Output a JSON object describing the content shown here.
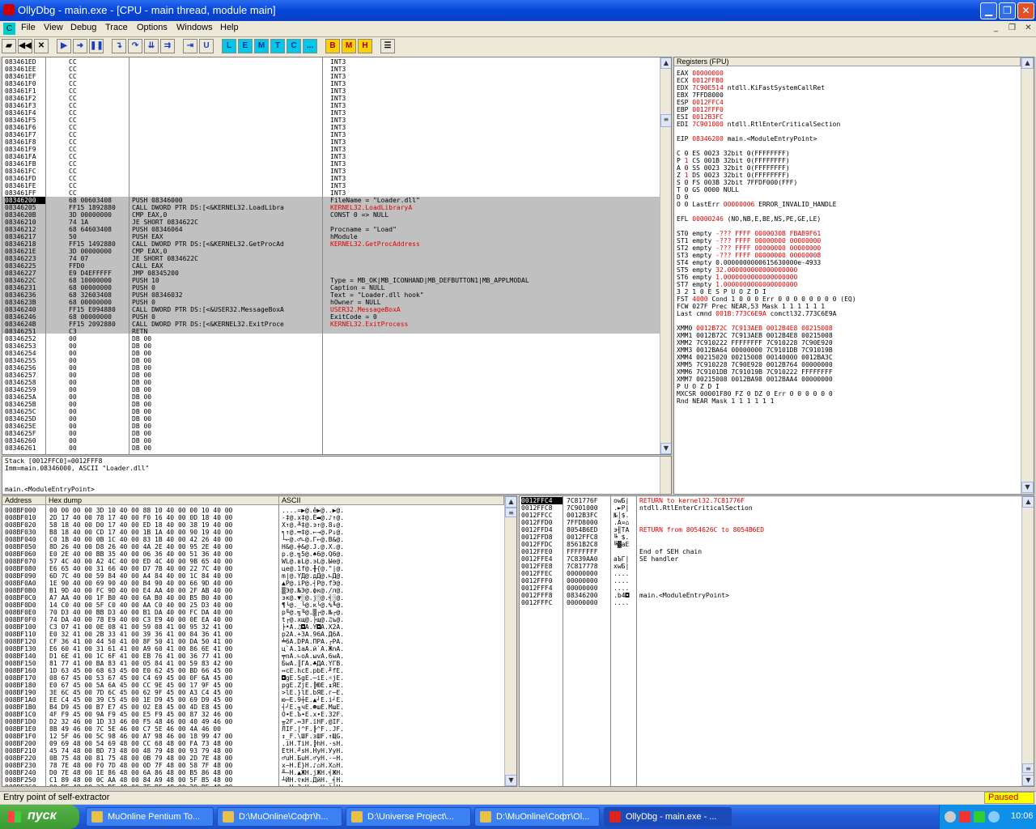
{
  "window": {
    "title": "OllyDbg - main.exe - [CPU - main thread, module main]",
    "minimize": "▁",
    "restore": "❐",
    "close": "✕"
  },
  "menu": {
    "icon": "C",
    "items": [
      "File",
      "View",
      "Debug",
      "Trace",
      "Options",
      "Windows",
      "Help"
    ],
    "mdi": [
      "_",
      "❐",
      "✕"
    ]
  },
  "toolbar": [
    "L",
    "E",
    "M",
    "T",
    "C",
    "...",
    "B",
    "M",
    "H"
  ],
  "disasm": {
    "rows": [
      [
        "083461ED",
        "CC",
        "",
        "INT3",
        "",
        ""
      ],
      [
        "083461EE",
        "CC",
        "",
        "INT3",
        "",
        ""
      ],
      [
        "083461EF",
        "CC",
        "",
        "INT3",
        "",
        ""
      ],
      [
        "083461F0",
        "CC",
        "",
        "INT3",
        "",
        ""
      ],
      [
        "083461F1",
        "CC",
        "",
        "INT3",
        "",
        ""
      ],
      [
        "083461F2",
        "CC",
        "",
        "INT3",
        "",
        ""
      ],
      [
        "083461F3",
        "CC",
        "",
        "INT3",
        "",
        ""
      ],
      [
        "083461F4",
        "CC",
        "",
        "INT3",
        "",
        ""
      ],
      [
        "083461F5",
        "CC",
        "",
        "INT3",
        "",
        ""
      ],
      [
        "083461F6",
        "CC",
        "",
        "INT3",
        "",
        ""
      ],
      [
        "083461F7",
        "CC",
        "",
        "INT3",
        "",
        ""
      ],
      [
        "083461F8",
        "CC",
        "",
        "INT3",
        "",
        ""
      ],
      [
        "083461F9",
        "CC",
        "",
        "INT3",
        "",
        ""
      ],
      [
        "083461FA",
        "CC",
        "",
        "INT3",
        "",
        ""
      ],
      [
        "083461FB",
        "CC",
        "",
        "INT3",
        "",
        ""
      ],
      [
        "083461FC",
        "CC",
        "",
        "INT3",
        "",
        ""
      ],
      [
        "083461FD",
        "CC",
        "",
        "INT3",
        "",
        ""
      ],
      [
        "083461FE",
        "CC",
        "",
        "INT3",
        "",
        ""
      ],
      [
        "083461FF",
        "CC",
        "",
        "INT3",
        "",
        ""
      ],
      [
        "08346200",
        "68 00603408",
        "PUSH 08346000",
        "FileName = \"Loader.dll\"",
        "g",
        "s"
      ],
      [
        "08346205",
        "FF15 1892880",
        "CALL DWORD PTR DS:[<&KERNEL32.LoadLibra",
        "KERNEL32.LoadLibraryA",
        "r",
        "h"
      ],
      [
        "0834620B",
        "3D 00000000",
        "CMP EAX,0",
        "CONST 0 => NULL",
        "",
        "h"
      ],
      [
        "08346210",
        "74 1A",
        "JE SHORT 0834622C",
        "",
        "",
        "h"
      ],
      [
        "08346212",
        "68 64603408",
        "PUSH 08346064",
        "Procname = \"Load\"",
        "g",
        "h"
      ],
      [
        "08346217",
        "50",
        "PUSH EAX",
        "hModule",
        "g",
        "h"
      ],
      [
        "08346218",
        "FF15 1492880",
        "CALL DWORD PTR DS:[<&KERNEL32.GetProcAd",
        "KERNEL32.GetProcAddress",
        "r",
        "h"
      ],
      [
        "0834621E",
        "3D 00000000",
        "CMP EAX,0",
        "",
        "",
        "h"
      ],
      [
        "08346223",
        "74 07",
        "JE SHORT 0834622C",
        "",
        "",
        "h"
      ],
      [
        "08346225",
        "FFD0",
        "CALL EAX",
        "",
        "",
        "h"
      ],
      [
        "08346227",
        "E9 D4EFFFFF",
        "JMP 08345200",
        "",
        "",
        "h"
      ],
      [
        "0834622C",
        "68 10000000",
        "PUSH 10",
        "Type = MB_OK|MB_ICONHAND|MB_DEFBUTTON1|MB_APPLMODAL",
        "g",
        "h"
      ],
      [
        "08346231",
        "68 00000000",
        "PUSH 0",
        "Caption = NULL",
        "g",
        "h"
      ],
      [
        "08346236",
        "68 32603408",
        "PUSH 08346032",
        "Text = \"Loader.dll hook\"",
        "g",
        "h"
      ],
      [
        "0834623B",
        "68 00000000",
        "PUSH 0",
        "hOwner = NULL",
        "g",
        "h"
      ],
      [
        "08346240",
        "FF15 E094880",
        "CALL DWORD PTR DS:[<&USER32.MessageBoxA",
        "USER32.MessageBoxA",
        "r",
        "h"
      ],
      [
        "08346246",
        "68 00000000",
        "PUSH 0",
        "ExitCode = 0",
        "g",
        "h"
      ],
      [
        "0834624B",
        "FF15 2092880",
        "CALL DWORD PTR DS:[<&KERNEL32.ExitProce",
        "KERNEL32.ExitProcess",
        "r",
        "h"
      ],
      [
        "08346251",
        "C3",
        "RETN",
        "",
        "",
        "h"
      ],
      [
        "08346252",
        "00",
        "DB 00",
        "",
        "",
        ""
      ],
      [
        "08346253",
        "00",
        "DB 00",
        "",
        "",
        ""
      ],
      [
        "08346254",
        "00",
        "DB 00",
        "",
        "",
        ""
      ],
      [
        "08346255",
        "00",
        "DB 00",
        "",
        "",
        ""
      ],
      [
        "08346256",
        "00",
        "DB 00",
        "",
        "",
        ""
      ],
      [
        "08346257",
        "00",
        "DB 00",
        "",
        "",
        ""
      ],
      [
        "08346258",
        "00",
        "DB 00",
        "",
        "",
        ""
      ],
      [
        "08346259",
        "00",
        "DB 00",
        "",
        "",
        ""
      ],
      [
        "0834625A",
        "00",
        "DB 00",
        "",
        "",
        ""
      ],
      [
        "0834625B",
        "00",
        "DB 00",
        "",
        "",
        ""
      ],
      [
        "0834625C",
        "00",
        "DB 00",
        "",
        "",
        ""
      ],
      [
        "0834625D",
        "00",
        "DB 00",
        "",
        "",
        ""
      ],
      [
        "0834625E",
        "00",
        "DB 00",
        "",
        "",
        ""
      ],
      [
        "0834625F",
        "00",
        "DB 00",
        "",
        "",
        ""
      ],
      [
        "08346260",
        "00",
        "DB 00",
        "",
        "",
        ""
      ],
      [
        "08346261",
        "00",
        "DB 00",
        "",
        "",
        ""
      ]
    ]
  },
  "info": {
    "line1": "Stack [0012FFC0]=0012FFF8",
    "line2": "Imm=main.08346000, ASCII \"Loader.dll\"",
    "line3": "main.<ModuleEntryPoint>"
  },
  "registers": {
    "header": "Registers (FPU)",
    "lines": [
      [
        "EAX ",
        "00000000",
        ""
      ],
      [
        "ECX ",
        "0012FFB0",
        ""
      ],
      [
        "EDX ",
        "7C90E514",
        " ntdll.KiFastSystemCallRet"
      ],
      [
        "EBX 7FFD8000",
        "",
        ""
      ],
      [
        "ESP ",
        "0012FFC4",
        ""
      ],
      [
        "EBP ",
        "0012FFF0",
        ""
      ],
      [
        "ESI ",
        "0012B3FC",
        ""
      ],
      [
        "EDI ",
        "7C901000",
        " ntdll.RtlEnterCriticalSection"
      ],
      [
        "",
        "",
        ""
      ],
      [
        "EIP ",
        "08346200",
        " main.<ModuleEntryPoint>"
      ],
      [
        "",
        "",
        ""
      ],
      [
        "C 0  ES 0023 32bit 0(FFFFFFFF)",
        "",
        ""
      ],
      [
        "P ",
        "1",
        "  CS 001B 32bit 0(FFFFFFFF)"
      ],
      [
        "A 0  SS 0023 32bit 0(FFFFFFFF)",
        "",
        ""
      ],
      [
        "Z ",
        "1",
        "  DS 0023 32bit 0(FFFFFFFF)"
      ],
      [
        "S 0  FS 003B 32bit 7FFDF000(FFF)",
        "",
        ""
      ],
      [
        "T 0  GS 0000 NULL",
        "",
        ""
      ],
      [
        "D 0",
        "",
        ""
      ],
      [
        "O 0  LastErr ",
        "00000006",
        " ERROR_INVALID_HANDLE"
      ],
      [
        "",
        "",
        ""
      ],
      [
        "EFL ",
        "00000246",
        " (NO,NB,E,BE,NS,PE,GE,LE)"
      ],
      [
        "",
        "",
        ""
      ],
      [
        "ST0 empty ",
        "-??? FFFF 0000030B FBAB9F61",
        ""
      ],
      [
        "ST1 empty ",
        "-??? FFFF 00000000 00000000",
        ""
      ],
      [
        "ST2 empty ",
        "-??? FFFF 00000000 00000000",
        ""
      ],
      [
        "ST3 empty ",
        "-??? FFFF 00000000 00000008",
        ""
      ],
      [
        "ST4 empty 0.0000000000615630000e-4933",
        "",
        ""
      ],
      [
        "ST5 empty ",
        "32.000000000000000000",
        ""
      ],
      [
        "ST6 empty ",
        "1.0000000000000000000",
        ""
      ],
      [
        "ST7 empty ",
        "1.0000000000000000000",
        ""
      ],
      [
        "               3 2 1 0      E S P U O Z D I",
        "",
        ""
      ],
      [
        "FST ",
        "4000",
        "  Cond 1 0 0 0  Err 0 0 0 0 0 0 0 0  (EQ)"
      ],
      [
        "FCW 027F  Prec NEAR,53  Mask    1 1 1 1 1 1",
        "",
        ""
      ],
      [
        "Last cmnd ",
        "001B:773C6E9A",
        " comctl32.773C6E9A"
      ],
      [
        "",
        "",
        ""
      ],
      [
        "XMM0 ",
        "0012B72C 7C913AEB 0012B4E8 00215008",
        ""
      ],
      [
        "XMM1 0012B72C 7C913AEB 0012B4E8 00215008",
        "",
        ""
      ],
      [
        "XMM2 7C910222 FFFFFFFF 7C910228 7C90E920",
        "",
        ""
      ],
      [
        "XMM3 0012BA64 00000000 7C9101DB 7C91019B",
        "",
        ""
      ],
      [
        "XMM4 00215020 00215008 00140000 0012BA3C",
        "",
        ""
      ],
      [
        "XMM5 7C910228 7C90E920 0012B764 00000000",
        "",
        ""
      ],
      [
        "XMM6 7C9101DB 7C91019B 7C910222 FFFFFFFF",
        "",
        ""
      ],
      [
        "XMM7 00215008 0012BA98 0012BAA4 00000000",
        "",
        ""
      ],
      [
        "                                P U O Z D I",
        "",
        ""
      ],
      [
        "MXCSR 00001F80  FZ 0 DZ 0  Err  0 0 0 0 0 0",
        "",
        ""
      ],
      [
        "                Rnd NEAR   Mask  1 1 1 1 1 1",
        "",
        ""
      ]
    ]
  },
  "dump": {
    "h_addr": "Address",
    "h_hex": "Hex dump",
    "h_ascii": "ASCII",
    "rows": [
      [
        "008BF000",
        "00 00 00 00 3D 10 40 00 88 10 40 00 00 10 40 00",
        "....=▶@.ê▶@..▶@."
      ],
      [
        "008BF010",
        "2D 17 40 00 78 17 40 00 F0 16 40 00 0D 18 40 00",
        "-‡@.x‡@.Ё▬@.♪↑@."
      ],
      [
        "008BF020",
        "58 18 40 00 D0 17 40 00 ED 18 40 00 38 19 40 00",
        "X↑@.╨‡@.э↑@.8↓@."
      ],
      [
        "008BF030",
        "B8 18 40 00 CD 17 40 00 1B 1A 40 00 90 19 40 00",
        "╕↑@.═‡@.←→@.Р↓@."
      ],
      [
        "008BF040",
        "C0 1B 40 00 0B 1C 40 00 83 1B 40 00 42 26 40 00",
        "└←@.♂∟@.Г←@.B&@."
      ],
      [
        "008BF050",
        "8D 26 40 00 D8 26 40 00 4A 2E 40 00 95 2E 40 00",
        "Н&@.╪&@.J.@.Х.@."
      ],
      [
        "008BF060",
        "E0 2E 40 00 BB 35 40 00 06 36 40 00 51 36 40 00",
        "р.@.╗5@.♠6@.Q6@."
      ],
      [
        "008BF070",
        "57 4C 40 00 A2 4C 40 00 ED 4C 40 00 9B 65 40 00",
        "WL@.вL@.эL@.Ые@."
      ],
      [
        "008BF080",
        "E6 65 40 00 31 66 40 00 D7 7B 40 00 22 7C 40 00",
        "це@.1f@.╫{@.\"|@."
      ],
      [
        "008BF090",
        "6D 7C 40 00 59 84 40 00 A4 84 40 00 1C 84 40 00",
        "m|@.YД@.дД@.∟Д@."
      ],
      [
        "008BF0A0",
        "1E 90 40 00 69 90 40 00 B4 90 40 00 66 9D 40 00",
        "▲Р@.iР@.┤Р@.fЭ@."
      ],
      [
        "008BF0B0",
        "B1 9D 40 00 FC 9D 40 00 E4 AA 40 00 2F AB 40 00",
        "▒Э@.№Э@.фк@./л@."
      ],
      [
        "008BF0C0",
        "A7 AA 40 00 1F B0 40 00 6A B0 40 00 B5 B0 40 00",
        "зк@.▼░@.j░@.╡░@."
      ],
      [
        "008BF0D0",
        "14 C0 40 00 5F C0 40 00 AA C0 40 00 25 D3 40 00",
        "¶└@._└@.к└@.%╙@."
      ],
      [
        "008BF0E0",
        "70 D3 40 00 BB D3 40 00 B1 DA 40 00 FC DA 40 00",
        "p╙@.╗╙@.▒┌@.№┌@."
      ],
      [
        "008BF0F0",
        "74 DA 40 00 78 E9 40 00 C3 E9 40 00 0E EA 40 00",
        "t┌@.xщ@.├щ@.♫ъ@."
      ],
      [
        "008BF100",
        "C3 07 41 00 0E 08 41 00 59 08 41 00 95 32 41 00",
        "├•A.♫◘A.Y◘A.Х2A."
      ],
      [
        "008BF110",
        "E0 32 41 00 2B 33 41 00 39 36 41 00 84 36 41 00",
        "р2A.+3A.96A.Д6A."
      ],
      [
        "008BF120",
        "CF 36 41 00 44 50 41 00 8F 50 41 00 DA 50 41 00",
        "╧6A.DPA.ПPA.┌PA."
      ],
      [
        "008BF130",
        "E6 60 41 00 31 61 41 00 A9 60 41 00 86 6E 41 00",
        "ц`A.1aA.й`A.ЖnA."
      ],
      [
        "008BF140",
        "D1 6E 41 00 1C 6F 41 00 EB 76 41 00 36 77 41 00",
        "╤nA.∟oA.ыvA.6wA."
      ],
      [
        "008BF150",
        "81 77 41 00 BA 83 41 00 05 84 41 00 59 83 42 00",
        "БwA.║ГA.♣ДA.YГB."
      ],
      [
        "008BF160",
        "1D 63 45 00 68 63 45 00 E0 62 45 00 BD 66 45 00",
        "↔cE.hcE.рbE.╜fE."
      ],
      [
        "008BF170",
        "08 67 45 00 53 67 45 00 C4 69 45 00 0F 6A 45 00",
        "◘gE.SgE.─iE.☼jE."
      ],
      [
        "008BF180",
        "E0 67 45 00 5A 6A 45 00 CC 9E 45 00 17 9F 45 00",
        "рgE.ZjE.╠ЮE.↨ЯE."
      ],
      [
        "008BF190",
        "3E 6C 45 00 7D 6C 45 00 62 9F 45 00 A3 C4 45 00",
        ">lE.}lE.bЯE.г─E."
      ],
      [
        "008BF1A0",
        "EE C4 45 00 39 C5 45 00 1E D9 45 00 69 D9 45 00",
        "ю─E.9┼E.▲┘E.i┘E."
      ],
      [
        "008BF1B0",
        "B4 D9 45 00 B7 E7 45 00 02 E8 45 00 4D E8 45 00",
        "┤┘E.╖чE.☻шE.MшE."
      ],
      [
        "008BF1C0",
        "4F F9 45 00 9A F9 45 00 E5 F9 45 00 87 32 46 00",
        "O∙E.Ъ∙E.х∙E.З2F."
      ],
      [
        "008BF1D0",
        "D2 32 46 00 1D 33 46 00 F5 48 46 00 40 49 46 00",
        "╥2F.↔3F.їHF.@IF."
      ],
      [
        "008BF1E0",
        "8B 49 46 00 7C 5E 46 00 C7 5E 46 00 4A 46 00",
        "ЛIF.|^F.╟^F..JF."
      ],
      [
        "008BF1F0",
        "12 5F 46 00 5C 98 46 00 A7 98 46 00 18 99 47 00",
        "↕_F.\\ШF.зШF.↑ЩG."
      ],
      [
        "008BF200",
        "09 69 48 00 54 69 48 00 CC 68 48 00 FA 73 48 00",
        ".iH.TiH.╠hH.·sH."
      ],
      [
        "008BF210",
        "45 74 48 00 BD 73 48 00 48 79 48 00 93 79 48 00",
        "EtH.╜sH.HyH.УyH."
      ],
      [
        "008BF220",
        "0B 75 48 00 81 75 48 00 0B 79 48 00 2D 7E 48 00",
        "♂uH.БuH.♂yH.-~H."
      ],
      [
        "008BF230",
        "78 7E 48 00 F0 7D 48 00 0D 7F 48 00 58 7F 48 00",
        "x~H.Ё}H.♪⌂H.X⌂H."
      ],
      [
        "008BF240",
        "D0 7E 48 00 1E 86 48 00 6A 86 48 00 B5 86 48 00",
        "╨~H.▲ЖH.jЖH.╡ЖH."
      ],
      [
        "008BF250",
        "C1 89 48 00 0C AA 48 00 84 A9 48 00 5F B5 48 00",
        "┴ЙH.♀кH.ДйH._╡H."
      ],
      [
        "008BF260",
        "00 BF 48 00 33 BF 48 00 7E BF 48 00 29 BE 48 00",
        ".┐H.3┐H.~┐H.)╛H."
      ]
    ]
  },
  "stack": {
    "rows": [
      [
        "0012FFC4",
        "7C81776F",
        "owБ|",
        "RETURN to kernel32.7C81776F",
        "r"
      ],
      [
        "0012FFC8",
        "7C901000",
        ".►P|",
        "ntdll.RtlEnterCriticalSection",
        ""
      ],
      [
        "0012FFCC",
        "0012B3FC",
        "№│$.",
        "",
        ""
      ],
      [
        "0012FFD0",
        "7FFD8000",
        ".А¤⌂",
        "",
        ""
      ],
      [
        "0012FFD4",
        "8054B6ED",
        "э╢TА",
        "RETURN from 8054626C to 8054B6ED",
        "r"
      ],
      [
        "0012FFD8",
        "0012FFC8",
        "╚ $.",
        "",
        ""
      ],
      [
        "0012FFDC",
        "8561B2C8",
        "╚▓aЕ",
        "",
        ""
      ],
      [
        "0012FFE0",
        "FFFFFFFF",
        "    ",
        "End of SEH chain",
        ""
      ],
      [
        "0012FFE4",
        "7C839AA0",
        "аЪГ|",
        "SE handler",
        ""
      ],
      [
        "0012FFE8",
        "7C817778",
        "xwБ|",
        "",
        ""
      ],
      [
        "0012FFEC",
        "00000000",
        "....",
        "",
        ""
      ],
      [
        "0012FFF0",
        "00000000",
        "....",
        "",
        ""
      ],
      [
        "0012FFF4",
        "00000000",
        "....",
        "",
        ""
      ],
      [
        "0012FFF8",
        "08346200",
        ".b4◘",
        "main.<ModuleEntryPoint>",
        ""
      ],
      [
        "0012FFFC",
        "00000000",
        "....",
        "",
        ""
      ]
    ]
  },
  "status": {
    "text": "Entry point of self-extractor",
    "state": "Paused"
  },
  "taskbar": {
    "start": "пуск",
    "tasks": [
      "MuOnline Pentium To...",
      "D:\\MuOnline\\Софт\\h...",
      "D:\\Universe Project\\...",
      "D:\\MuOnline\\Софт\\Ol...",
      "OllyDbg - main.exe - ..."
    ],
    "clock": "10:06"
  },
  "colors": {
    "accent": "#0a3fc6",
    "red": "#e00000",
    "highlight": "#c0c0c0",
    "paused": "#ffff00"
  }
}
